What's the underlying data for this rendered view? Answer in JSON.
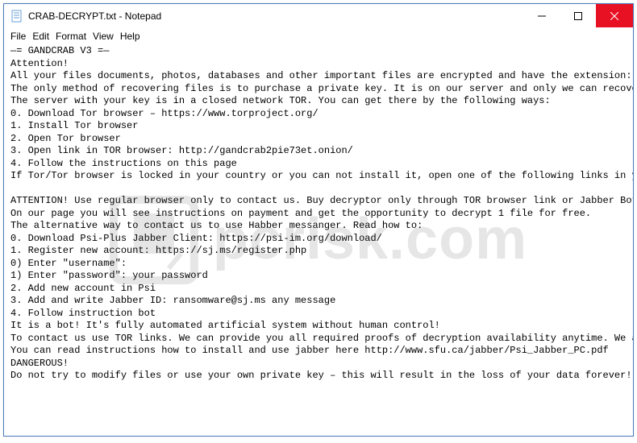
{
  "titlebar": {
    "title": "CRAB-DECRYPT.txt - Notepad"
  },
  "menubar": {
    "items": [
      "File",
      "Edit",
      "Format",
      "View",
      "Help"
    ]
  },
  "content": {
    "lines": [
      "—= GANDCRAB V3 =—",
      "Attention!",
      "All your files documents, photos, databases and other important files are encrypted and have the extension: .CRAB",
      "The only method of recovering files is to purchase a private key. It is on our server and only we can recover you",
      "The server with your key is in a closed network TOR. You can get there by the following ways:",
      "0. Download Tor browser – https://www.torproject.org/",
      "1. Install Tor browser",
      "2. Open Tor browser",
      "3. Open link in TOR browser: http://gandcrab2pie73et.onion/",
      "4. Follow the instructions on this page",
      "If Tor/Tor browser is locked in your country or you can not install it, open one of the following links in your r",
      "",
      "ATTENTION! Use regular browser only to contact us. Buy decryptor only through TOR browser link or Jabber Bot!",
      "On our page you will see instructions on payment and get the opportunity to decrypt 1 file for free.",
      "The alternative way to contact us to use Habber messanger. Read how to:",
      "0. Download Psi-Plus Jabber Client: https://psi-im.org/download/",
      "1. Register new account: https://sj.ms/register.php",
      "0) Enter \"username\":",
      "1) Enter \"password\": your password",
      "2. Add new account in Psi",
      "3. Add and write Jabber ID: ransomware@sj.ms any message",
      "4. Follow instruction bot",
      "It is a bot! It's fully automated artificial system without human control!",
      "To contact us use TOR links. We can provide you all required proofs of decryption availability anytime. We are op",
      "You can read instructions how to install and use jabber here http://www.sfu.ca/jabber/Psi_Jabber_PC.pdf",
      "DANGEROUS!",
      "Do not try to modify files or use your own private key – this will result in the loss of your data forever!"
    ]
  },
  "watermark": {
    "text": "pcrisk.com"
  }
}
